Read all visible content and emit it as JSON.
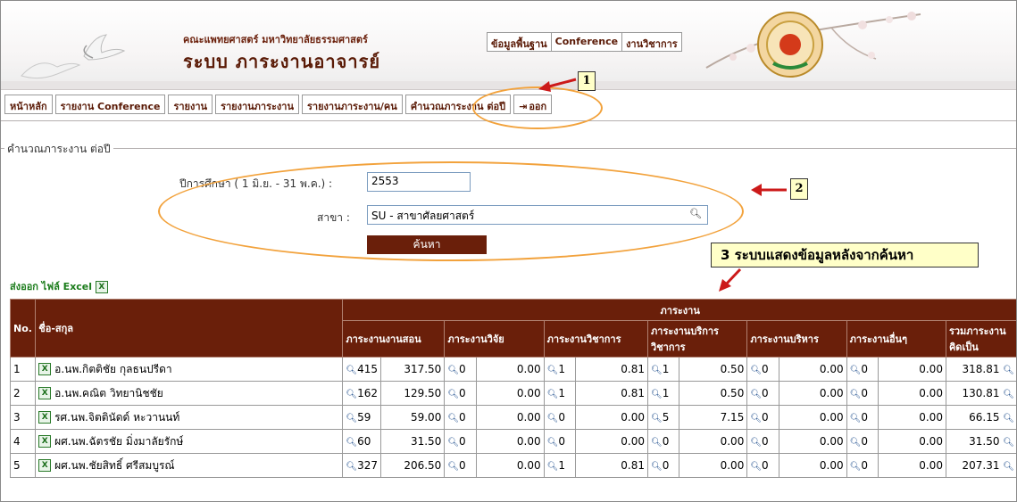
{
  "header": {
    "faculty": "คณะแพทยศาสตร์ มหาวิทยาลัยธรรมศาสตร์",
    "system_title": "ระบบ ภาระงานอาจารย์",
    "topnav": [
      "ข้อมูลพื้นฐาน",
      "Conference",
      "งานวิชาการ"
    ]
  },
  "tabs": [
    "หน้าหลัก",
    "รายงาน Conference",
    "รายงาน",
    "รายงานภาระงาน",
    "รายงานภาระงาน/คน",
    "คำนวณภาระงาน ต่อปี",
    "ออก"
  ],
  "annotations": {
    "n1": "1",
    "n2": "2",
    "callout": "3 ระบบแสดงข้อมูลหลังจากค้นหา"
  },
  "search": {
    "legend": "คำนวณภาระงาน ต่อปี",
    "year_label": "ปีการศึกษา ( 1 มิ.ย. - 31 พ.ค.) :",
    "year_value": "2553",
    "branch_label": "สาขา :",
    "branch_value": "SU - สาขาศัลยศาสตร์",
    "button": "ค้นหา"
  },
  "export": {
    "label": "ส่งออก ไฟล์ Excel"
  },
  "table": {
    "h_no": "No.",
    "h_name": "ชื่อ-สกุล",
    "h_group": "ภาระงาน",
    "h_cols": [
      "ภาระงานงานสอน",
      "ภาระงานวิจัย",
      "ภาระงานวิชาการ",
      "ภาระงานบริการวิชาการ",
      "ภาระงานบริหาร",
      "ภาระงานอื่นๆ",
      "รวมภาระงานคิดเป็น"
    ],
    "rows": [
      {
        "no": "1",
        "name": "อ.นพ.กิตติชัย กุลธนปรีดา",
        "c": [
          "Q415",
          "317.50",
          "Q0",
          "0.00",
          "Q1",
          "0.81",
          "Q1",
          "0.50",
          "Q0",
          "0.00",
          "Q0",
          "0.00",
          "318.81"
        ]
      },
      {
        "no": "2",
        "name": "อ.นพ.คณิต วิทยานิชชัย",
        "c": [
          "Q162",
          "129.50",
          "Q0",
          "0.00",
          "Q1",
          "0.81",
          "Q1",
          "0.50",
          "Q0",
          "0.00",
          "Q0",
          "0.00",
          "130.81"
        ]
      },
      {
        "no": "3",
        "name": "รศ.นพ.จิตตินัดด์ หะวานนท์",
        "c": [
          "Q59",
          "59.00",
          "Q0",
          "0.00",
          "Q0",
          "0.00",
          "Q5",
          "7.15",
          "Q0",
          "0.00",
          "Q0",
          "0.00",
          "66.15"
        ]
      },
      {
        "no": "4",
        "name": "ผศ.นพ.ฉัตรชัย มิ่งมาลัยรักษ์",
        "c": [
          "Q60",
          "31.50",
          "Q0",
          "0.00",
          "Q0",
          "0.00",
          "Q0",
          "0.00",
          "Q0",
          "0.00",
          "Q0",
          "0.00",
          "31.50"
        ]
      },
      {
        "no": "5",
        "name": "ผศ.นพ.ชัยสิทธิ์ ศรีสมบูรณ์",
        "c": [
          "Q327",
          "206.50",
          "Q0",
          "0.00",
          "Q1",
          "0.81",
          "Q0",
          "0.00",
          "Q0",
          "0.00",
          "Q0",
          "0.00",
          "207.31"
        ]
      }
    ]
  },
  "colors": {
    "brown": "#6a1f0a",
    "orange": "#f2a23c",
    "callout_bg": "#ffffc8",
    "arrow_red": "#cc1a1a"
  }
}
